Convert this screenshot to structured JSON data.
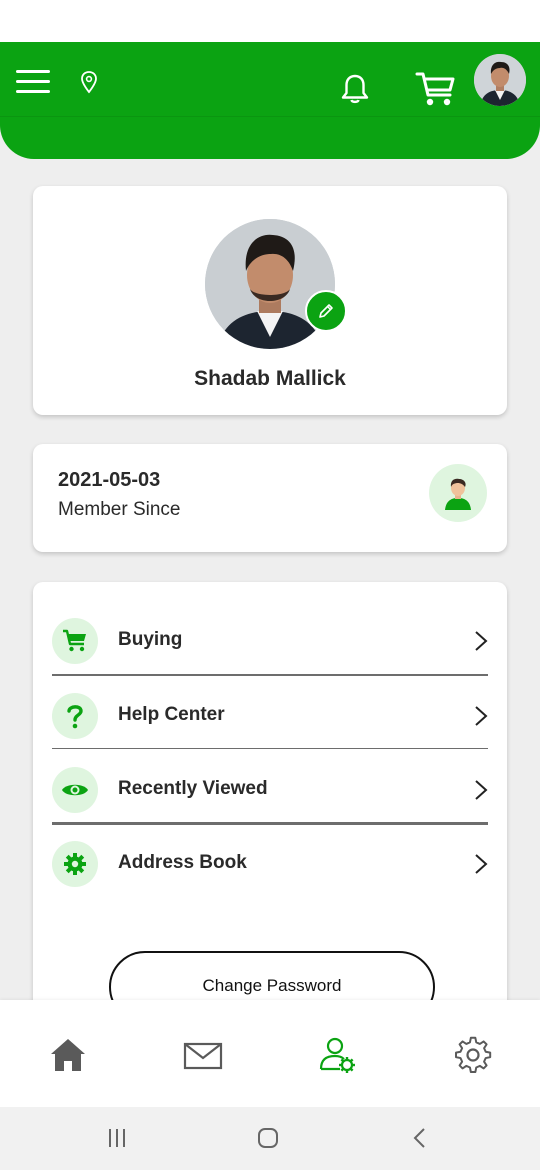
{
  "profile": {
    "name": "Shadab Mallick"
  },
  "member": {
    "date": "2021-05-03",
    "label": "Member Since"
  },
  "menu": {
    "items": [
      {
        "label": "Buying",
        "icon": "cart-icon"
      },
      {
        "label": "Help Center",
        "icon": "question-icon"
      },
      {
        "label": "Recently Viewed",
        "icon": "eye-icon"
      },
      {
        "label": "Address Book",
        "icon": "gear-icon"
      }
    ]
  },
  "actions": {
    "change_password": "Change Password"
  },
  "bottom_nav": {
    "items": [
      {
        "name": "home",
        "icon": "home-icon"
      },
      {
        "name": "messages",
        "icon": "mail-icon"
      },
      {
        "name": "account",
        "icon": "user-settings-icon",
        "active": true
      },
      {
        "name": "settings",
        "icon": "gear-icon"
      }
    ]
  },
  "colors": {
    "brand": "#0ba312",
    "icon_bg": "#dff5df",
    "text": "#2a2a2a"
  }
}
